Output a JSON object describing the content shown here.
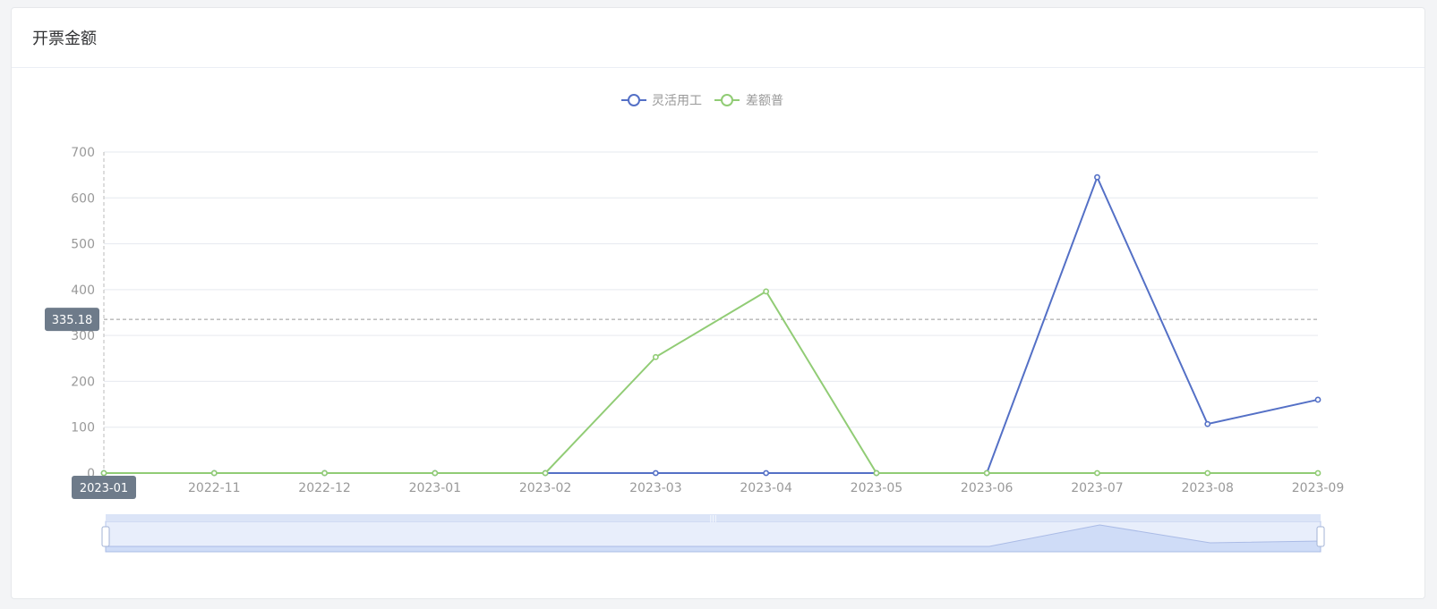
{
  "card": {
    "title": "开票金额"
  },
  "colors": {
    "series1": "#5470c6",
    "series2": "#91cc75",
    "grid": "#e6e9ef",
    "axis_text": "#999999",
    "pointer_bg": "#6e7b8a",
    "zoom_fill": "#e8eefb",
    "zoom_area": "#cfdcf7",
    "zoom_border": "#b9c8ee"
  },
  "pointer": {
    "x_label": "2023-01",
    "y_label": "335.18",
    "y_value": 335.18
  },
  "chart_data": {
    "type": "line",
    "title": "",
    "xlabel": "",
    "ylabel": "",
    "categories": [
      "2023-01",
      "2022-11",
      "2022-12",
      "2023-01",
      "2023-02",
      "2023-03",
      "2023-04",
      "2023-05",
      "2023-06",
      "2023-07",
      "2023-08",
      "2023-09"
    ],
    "ylim": [
      0,
      700
    ],
    "yticks": [
      0,
      100,
      200,
      300,
      400,
      500,
      600,
      700
    ],
    "grid": true,
    "legend": "top-center",
    "series": [
      {
        "name": "灵活用工",
        "values": [
          0,
          0,
          0,
          0,
          0,
          0,
          0,
          0,
          0,
          645,
          107,
          160
        ]
      },
      {
        "name": "差额普",
        "values": [
          0,
          0,
          0,
          0,
          0,
          253,
          396,
          0,
          0,
          0,
          0,
          0
        ]
      }
    ],
    "datazoom": {
      "start": 0,
      "end": 100
    }
  }
}
